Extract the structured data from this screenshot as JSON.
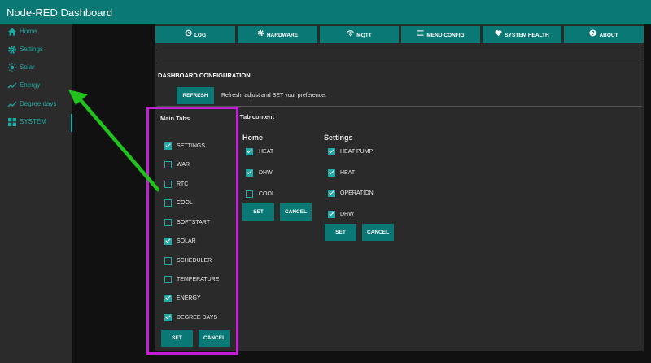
{
  "app": {
    "title": "Node-RED Dashboard"
  },
  "sidebar": {
    "items": [
      {
        "label": "Home",
        "icon": "home-icon"
      },
      {
        "label": "Settings",
        "icon": "gear-icon"
      },
      {
        "label": "Solar",
        "icon": "sun-icon"
      },
      {
        "label": "Energy",
        "icon": "trend-icon"
      },
      {
        "label": "Degree days",
        "icon": "trend-icon"
      },
      {
        "label": "SYSTEM",
        "icon": "grid-icon",
        "active": true
      }
    ]
  },
  "tabs": [
    {
      "label": "LOG",
      "icon": "history-icon"
    },
    {
      "label": "HARDWARE",
      "icon": "gear-icon"
    },
    {
      "label": "MQTT",
      "icon": "wifi-icon"
    },
    {
      "label": "MENU CONFIG",
      "icon": "menu-icon"
    },
    {
      "label": "SYSTEM HEALTH",
      "icon": "heart-icon"
    },
    {
      "label": "ABOUT",
      "icon": "help-icon"
    }
  ],
  "config": {
    "title": "DASHBOARD CONFIGURATION",
    "refresh_label": "REFRESH",
    "refresh_text": "Refresh, adjust and SET your preference."
  },
  "main_tabs": {
    "title": "Main Tabs",
    "items": [
      {
        "label": "SETTINGS",
        "checked": true
      },
      {
        "label": "WAR",
        "checked": false
      },
      {
        "label": "RTC",
        "checked": false
      },
      {
        "label": "COOL",
        "checked": false
      },
      {
        "label": "SOFTSTART",
        "checked": false
      },
      {
        "label": "SOLAR",
        "checked": true
      },
      {
        "label": "SCHEDULER",
        "checked": false
      },
      {
        "label": "TEMPERATURE",
        "checked": false
      },
      {
        "label": "ENERGY",
        "checked": true
      },
      {
        "label": "DEGREE DAYS",
        "checked": true
      }
    ],
    "set_label": "SET",
    "cancel_label": "CANCEL"
  },
  "tab_content": {
    "title": "Tab content",
    "home": {
      "title": "Home",
      "items": [
        {
          "label": "HEAT",
          "checked": true
        },
        {
          "label": "DHW",
          "checked": true
        },
        {
          "label": "COOL",
          "checked": false
        }
      ],
      "set_label": "SET",
      "cancel_label": "CANCEL"
    },
    "settings": {
      "title": "Settings",
      "items": [
        {
          "label": "HEAT PUMP",
          "checked": true
        },
        {
          "label": "HEAT",
          "checked": true
        },
        {
          "label": "OPERATION",
          "checked": true
        },
        {
          "label": "DHW",
          "checked": true
        }
      ],
      "set_label": "SET",
      "cancel_label": "CANCEL"
    }
  },
  "colors": {
    "accent": "#0a7874",
    "accent_light": "#1fa9a3",
    "highlight": "#c21fd6",
    "arrow": "#22c21e"
  }
}
